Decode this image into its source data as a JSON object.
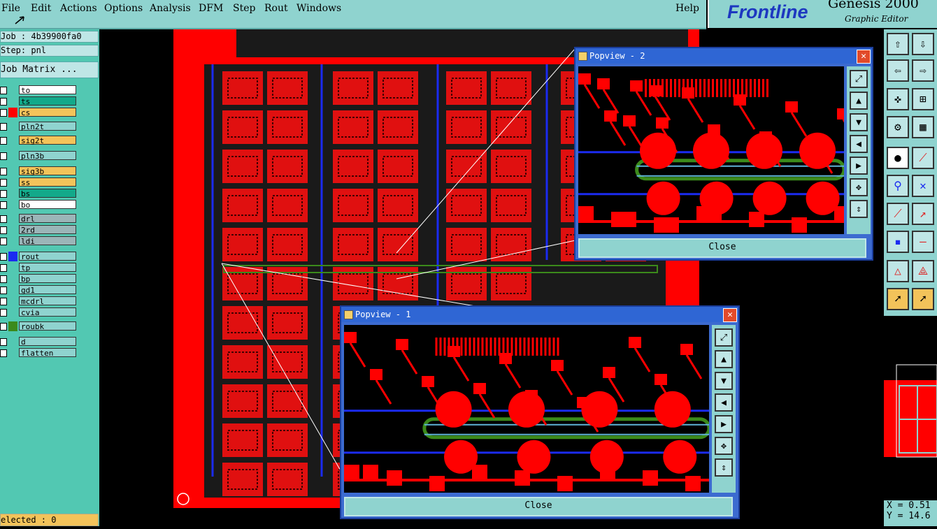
{
  "menu": [
    "File",
    "Edit",
    "Actions",
    "Options",
    "Analysis",
    "DFM",
    "Step",
    "Rout",
    "Windows"
  ],
  "help": "Help",
  "brand": {
    "logo": "Frontline",
    "title": "Genesis 2000",
    "sub": "Graphic Editor"
  },
  "job": {
    "job_label": "Job : 4b39900fa0",
    "step_label": "Step: pnl",
    "matrix_button": "Job Matrix ..."
  },
  "layers": [
    {
      "name": "to",
      "color": "#ffffff"
    },
    {
      "name": "ts",
      "color": "#13a98a"
    },
    {
      "name": "cs",
      "color": "#f3c35a"
    },
    {
      "name": "pln2t",
      "color": "#8fd3cf"
    },
    {
      "name": "sig2t",
      "color": "#f3c35a"
    },
    {
      "name": "pln3b",
      "color": "#8fd3cf"
    },
    {
      "name": "sig3b",
      "color": "#f3c35a"
    },
    {
      "name": "ss",
      "color": "#f3c35a"
    },
    {
      "name": "bs",
      "color": "#13a98a"
    },
    {
      "name": "bo",
      "color": "#ffffff"
    },
    {
      "name": "drl",
      "color": "#9bb5b8"
    },
    {
      "name": "2rd",
      "color": "#9bb5b8"
    },
    {
      "name": "ldi",
      "color": "#9bb5b8"
    },
    {
      "name": "rout",
      "color": "#8fd3cf"
    },
    {
      "name": "tp",
      "color": "#8fd3cf"
    },
    {
      "name": "bp",
      "color": "#8fd3cf"
    },
    {
      "name": "gd1",
      "color": "#8fd3cf"
    },
    {
      "name": "mcdrl",
      "color": "#8fd3cf"
    },
    {
      "name": "cvia",
      "color": "#8fd3cf"
    },
    {
      "name": "roubk",
      "color": "#8fd3cf"
    },
    {
      "name": "d",
      "color": "#8fd3cf"
    },
    {
      "name": "flatten",
      "color": "#8fd3cf"
    }
  ],
  "selected": "elected : 0",
  "popview2": {
    "title": "Popview - 2",
    "close": "Close"
  },
  "popview1": {
    "title": "Popview - 1",
    "close": "Close"
  },
  "coords": {
    "x": "X = 0.51",
    "y": "Y = 14.6"
  },
  "colors": {
    "board": "#ff0000",
    "trace": "#1b2bf0",
    "accent": "#3c6bd0",
    "panel": "#8fd3cf"
  }
}
